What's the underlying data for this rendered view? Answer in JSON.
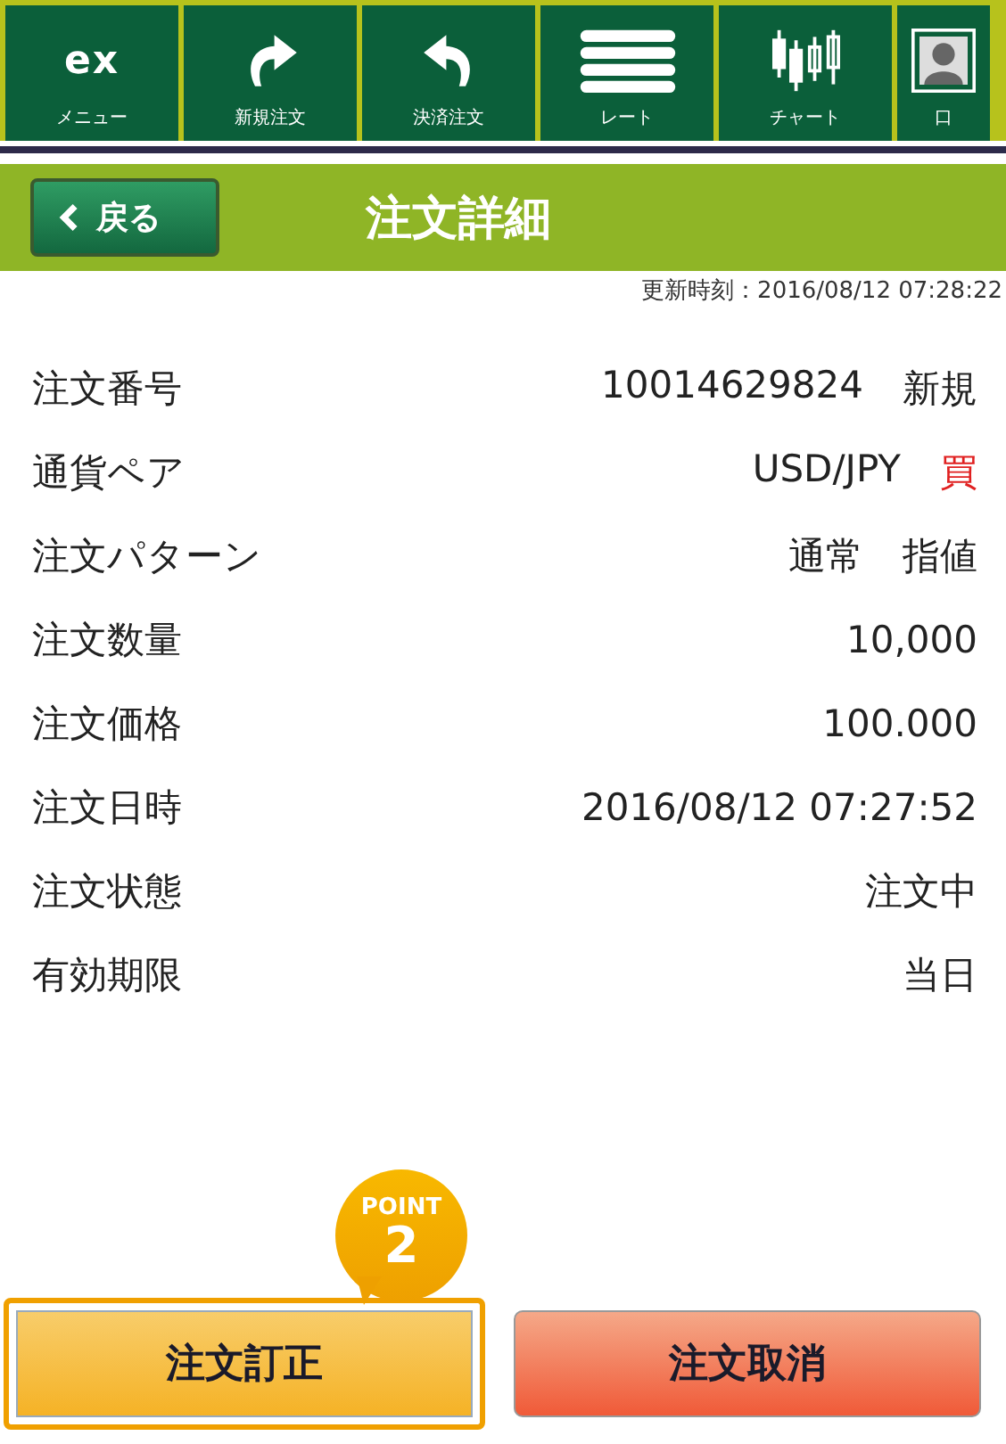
{
  "toolbar": [
    {
      "kind": "logo",
      "label": "メニュー",
      "logo": "ex"
    },
    {
      "kind": "redo",
      "label": "新規注文"
    },
    {
      "kind": "undo",
      "label": "決済注文"
    },
    {
      "kind": "list",
      "label": "レート"
    },
    {
      "kind": "chart",
      "label": "チャート"
    },
    {
      "kind": "person",
      "label": "口"
    }
  ],
  "header": {
    "back": "戻る",
    "title": "注文詳細"
  },
  "updated": "更新時刻：2016/08/12 07:28:22",
  "rows": [
    {
      "label": "注文番号",
      "values": [
        {
          "text": "10014629824"
        },
        {
          "text": "新規"
        }
      ]
    },
    {
      "label": "通貨ペア",
      "values": [
        {
          "text": "USD/JPY"
        },
        {
          "text": "買",
          "color": "#e02020"
        }
      ]
    },
    {
      "label": "注文パターン",
      "values": [
        {
          "text": "通常"
        },
        {
          "text": "指値"
        }
      ]
    },
    {
      "label": "注文数量",
      "values": [
        {
          "text": "10,000"
        }
      ]
    },
    {
      "label": "注文価格",
      "values": [
        {
          "text": "100.000"
        }
      ]
    },
    {
      "label": "注文日時",
      "values": [
        {
          "text": "2016/08/12 07:27:52"
        }
      ]
    },
    {
      "label": "注文状態",
      "values": [
        {
          "text": "注文中"
        }
      ]
    },
    {
      "label": "有効期限",
      "values": [
        {
          "text": "当日"
        }
      ]
    }
  ],
  "point": {
    "label": "POINT",
    "number": "2"
  },
  "buttons": [
    {
      "kind": "modify",
      "label": "注文訂正",
      "highlighted": true
    },
    {
      "kind": "cancel",
      "label": "注文取消",
      "highlighted": false
    }
  ]
}
